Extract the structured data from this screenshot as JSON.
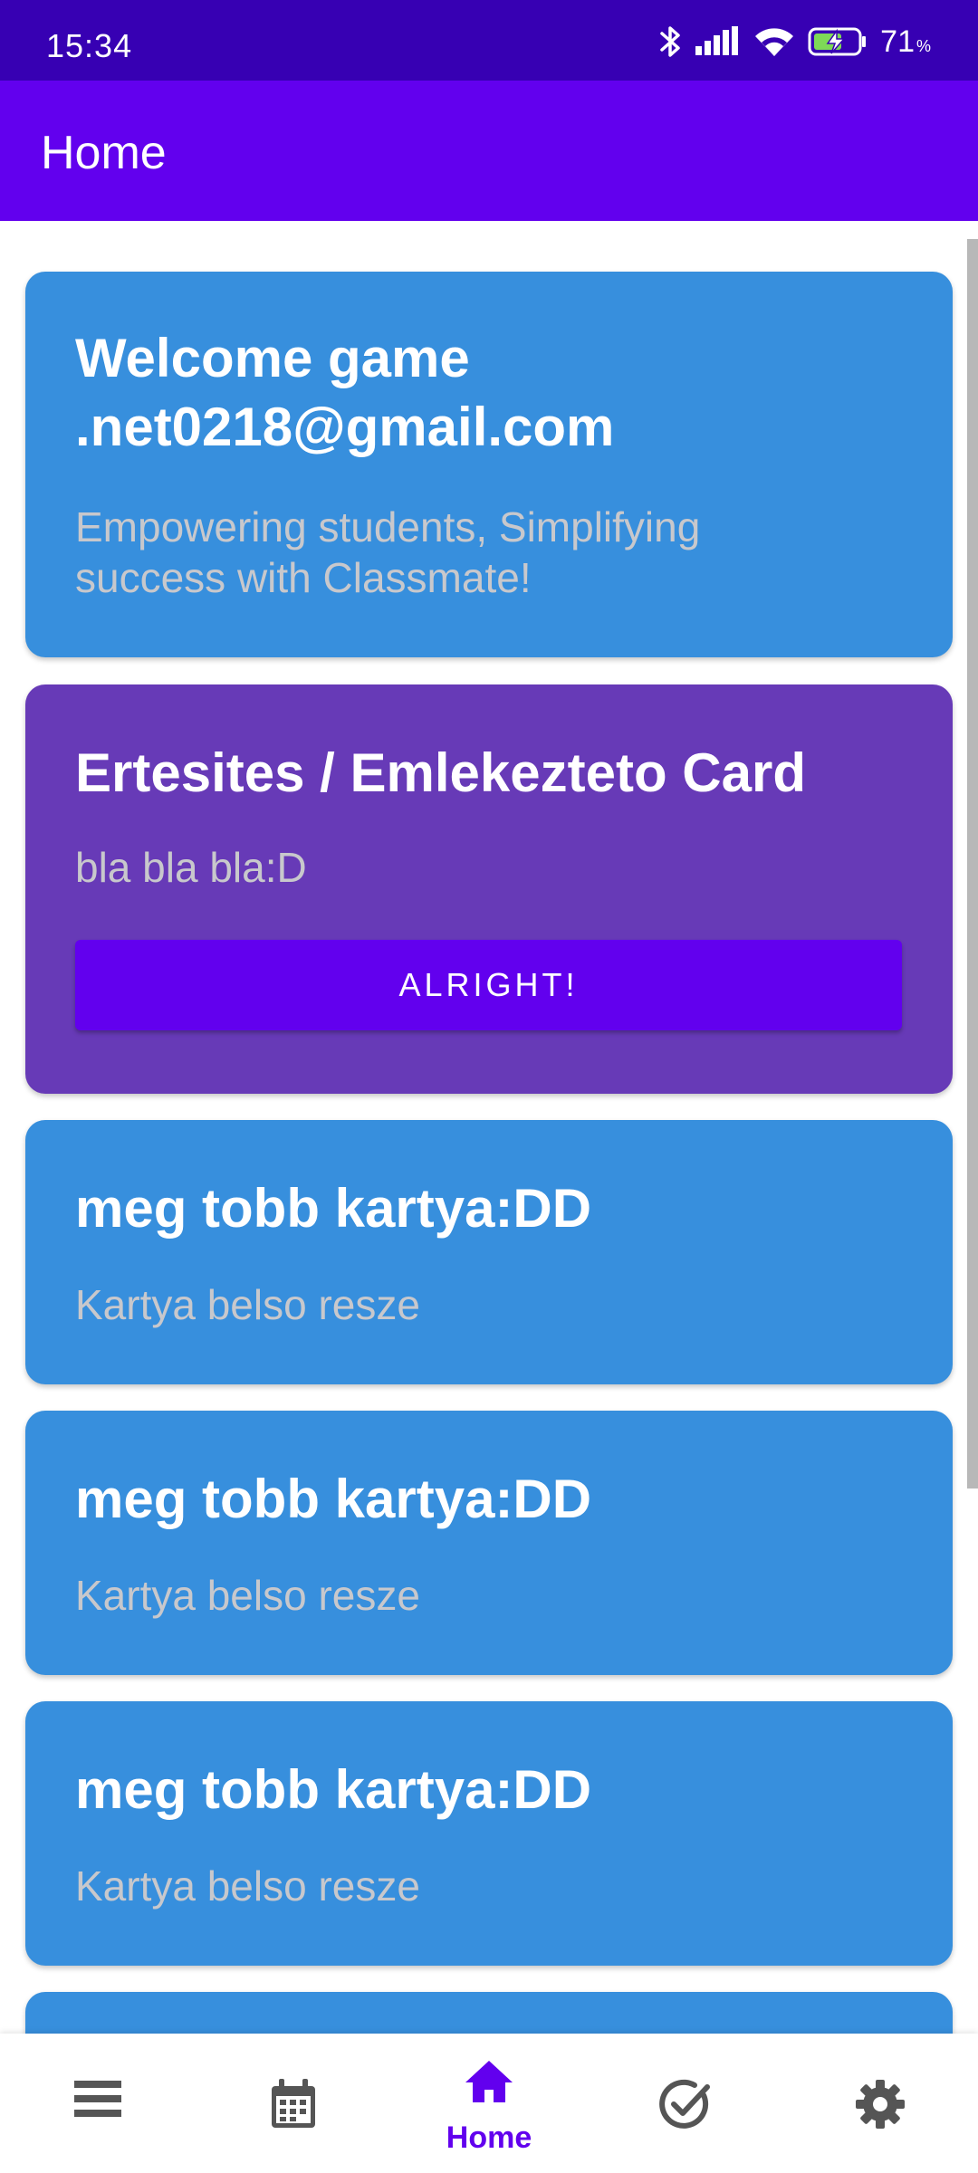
{
  "status_bar": {
    "time": "15:34",
    "battery_percent": "71",
    "battery_unit": "%",
    "icons": [
      "bluetooth-icon",
      "signal-icon",
      "wifi-icon",
      "battery-charging-icon"
    ]
  },
  "app_bar": {
    "title": "Home"
  },
  "cards": {
    "welcome": {
      "title_line1": "Welcome game",
      "title_line2": ".net0218@gmail.com",
      "body_line1": "Empowering students,  Simplifying",
      "body_line2": "success with Classmate!"
    },
    "notification": {
      "title": "Ertesites / Emlekezteto Card",
      "body": "bla bla bla:D",
      "button_label": "ALRIGHT!"
    },
    "more": [
      {
        "title": "meg tobb kartya:DD",
        "body": "Kartya belso resze"
      },
      {
        "title": "meg tobb kartya:DD",
        "body": "Kartya belso resze"
      },
      {
        "title": "meg tobb kartya:DD",
        "body": "Kartya belso resze"
      }
    ]
  },
  "bottom_nav": {
    "items": [
      {
        "icon": "menu-icon",
        "label": ""
      },
      {
        "icon": "calendar-icon",
        "label": ""
      },
      {
        "icon": "home-icon",
        "label": "Home",
        "active": true
      },
      {
        "icon": "check-circle-icon",
        "label": ""
      },
      {
        "icon": "gear-icon",
        "label": ""
      }
    ]
  },
  "colors": {
    "status_bar": "#3700b3",
    "primary": "#6200ee",
    "card_blue": "#378fdd",
    "card_purple": "#673ab7",
    "nav_icon_inactive": "#555555"
  }
}
